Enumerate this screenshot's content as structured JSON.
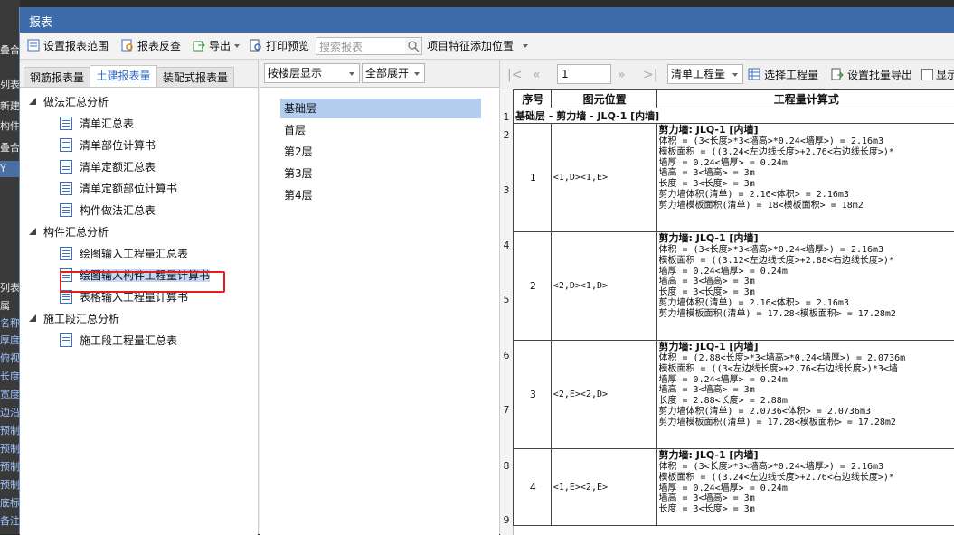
{
  "background_app": {
    "items": [
      "叠合",
      "列表",
      "新建",
      "构件",
      "叠合构",
      "Y",
      "列表",
      "属",
      "名称",
      "厚度",
      "俯视",
      "长度",
      "宽度",
      "边沿",
      "预制",
      "预制",
      "预制",
      "预制",
      "底标",
      "备注"
    ]
  },
  "window": {
    "title": "报表"
  },
  "toolbar": {
    "set_range": "设置报表范围",
    "reverse_check": "报表反查",
    "export": "导出",
    "print_preview": "打印预览",
    "search_placeholder": "搜索报表",
    "item_feature": "项目特征添加位置"
  },
  "left_tabs": [
    "钢筋报表量",
    "土建报表量",
    "装配式报表量"
  ],
  "tree": {
    "groups": [
      {
        "label": "做法汇总分析",
        "items": [
          "清单汇总表",
          "清单部位计算书",
          "清单定额汇总表",
          "清单定额部位计算书",
          "构件做法汇总表"
        ]
      },
      {
        "label": "构件汇总分析",
        "items": [
          "绘图输入工程量汇总表",
          "绘图输入构件工程量计算书",
          "表格输入工程量计算书"
        ]
      },
      {
        "label": "施工段汇总分析",
        "items": [
          "施工段工程量汇总表"
        ]
      }
    ]
  },
  "middle": {
    "display_mode": "按楼层显示",
    "expand_mode": "全部展开",
    "floors": [
      "基础层",
      "首层",
      "第2层",
      "第3层",
      "第4层"
    ]
  },
  "right_toolbar": {
    "page": "1",
    "qty_type": "清单工程量",
    "select_qty": "选择工程量",
    "batch_export": "设置批量导出",
    "show": "显示"
  },
  "report": {
    "headers": [
      "序号",
      "图元位置",
      "工程量计算式"
    ],
    "section": "基础层 - 剪力墙 - JLQ-1 [内墙]",
    "row_numbers": [
      "1",
      "2",
      "3",
      "4",
      "5",
      "6",
      "7",
      "8",
      "9"
    ],
    "records": [
      {
        "no": "1",
        "pos": "<1,D><1,E>",
        "lines": [
          "剪力墙: JLQ-1 [内墙]",
          "体积 = (3<长度>*3<墙高>*0.24<墙厚>) = 2.16m3",
          "模板面积 = ((3.24<左边线长度>+2.76<右边线长度>)*",
          "墙厚 = 0.24<墙厚> = 0.24m",
          "墙高 = 3<墙高> = 3m",
          "长度 = 3<长度> = 3m",
          "剪力墙体积(清单) = 2.16<体积> = 2.16m3",
          "剪力墙模板面积(清单) = 18<模板面积> = 18m2"
        ]
      },
      {
        "no": "2",
        "pos": "<2,D><1,D>",
        "lines": [
          "剪力墙: JLQ-1 [内墙]",
          "体积 = (3<长度>*3<墙高>*0.24<墙厚>) = 2.16m3",
          "模板面积 = ((3.12<左边线长度>+2.88<右边线长度>)*",
          "墙厚 = 0.24<墙厚> = 0.24m",
          "墙高 = 3<墙高> = 3m",
          "长度 = 3<长度> = 3m",
          "剪力墙体积(清单) = 2.16<体积> = 2.16m3",
          "剪力墙模板面积(清单) = 17.28<模板面积> = 17.28m2"
        ]
      },
      {
        "no": "3",
        "pos": "<2,E><2,D>",
        "lines": [
          "剪力墙: JLQ-1 [内墙]",
          "体积 = (2.88<长度>*3<墙高>*0.24<墙厚>) = 2.0736m",
          "模板面积 = ((3<左边线长度>+2.76<右边线长度>)*3<墙",
          "墙厚 = 0.24<墙厚> = 0.24m",
          "墙高 = 3<墙高> = 3m",
          "长度 = 2.88<长度> = 2.88m",
          "剪力墙体积(清单) = 2.0736<体积> = 2.0736m3",
          "剪力墙模板面积(清单) = 17.28<模板面积> = 17.28m2"
        ]
      },
      {
        "no": "4",
        "pos": "<1,E><2,E>",
        "lines": [
          "剪力墙: JLQ-1 [内墙]",
          "体积 = (3<长度>*3<墙高>*0.24<墙厚>) = 2.16m3",
          "模板面积 = ((3.24<左边线长度>+2.76<右边线长度>)*",
          "墙厚 = 0.24<墙厚> = 0.24m",
          "墙高 = 3<墙高> = 3m",
          "长度 = 3<长度> = 3m"
        ]
      }
    ]
  },
  "colors": {
    "title_bar": "#3d6baa",
    "highlight": "#e02020",
    "selected": "#b3cdef",
    "active_tab_text": "#2d6bc4"
  }
}
